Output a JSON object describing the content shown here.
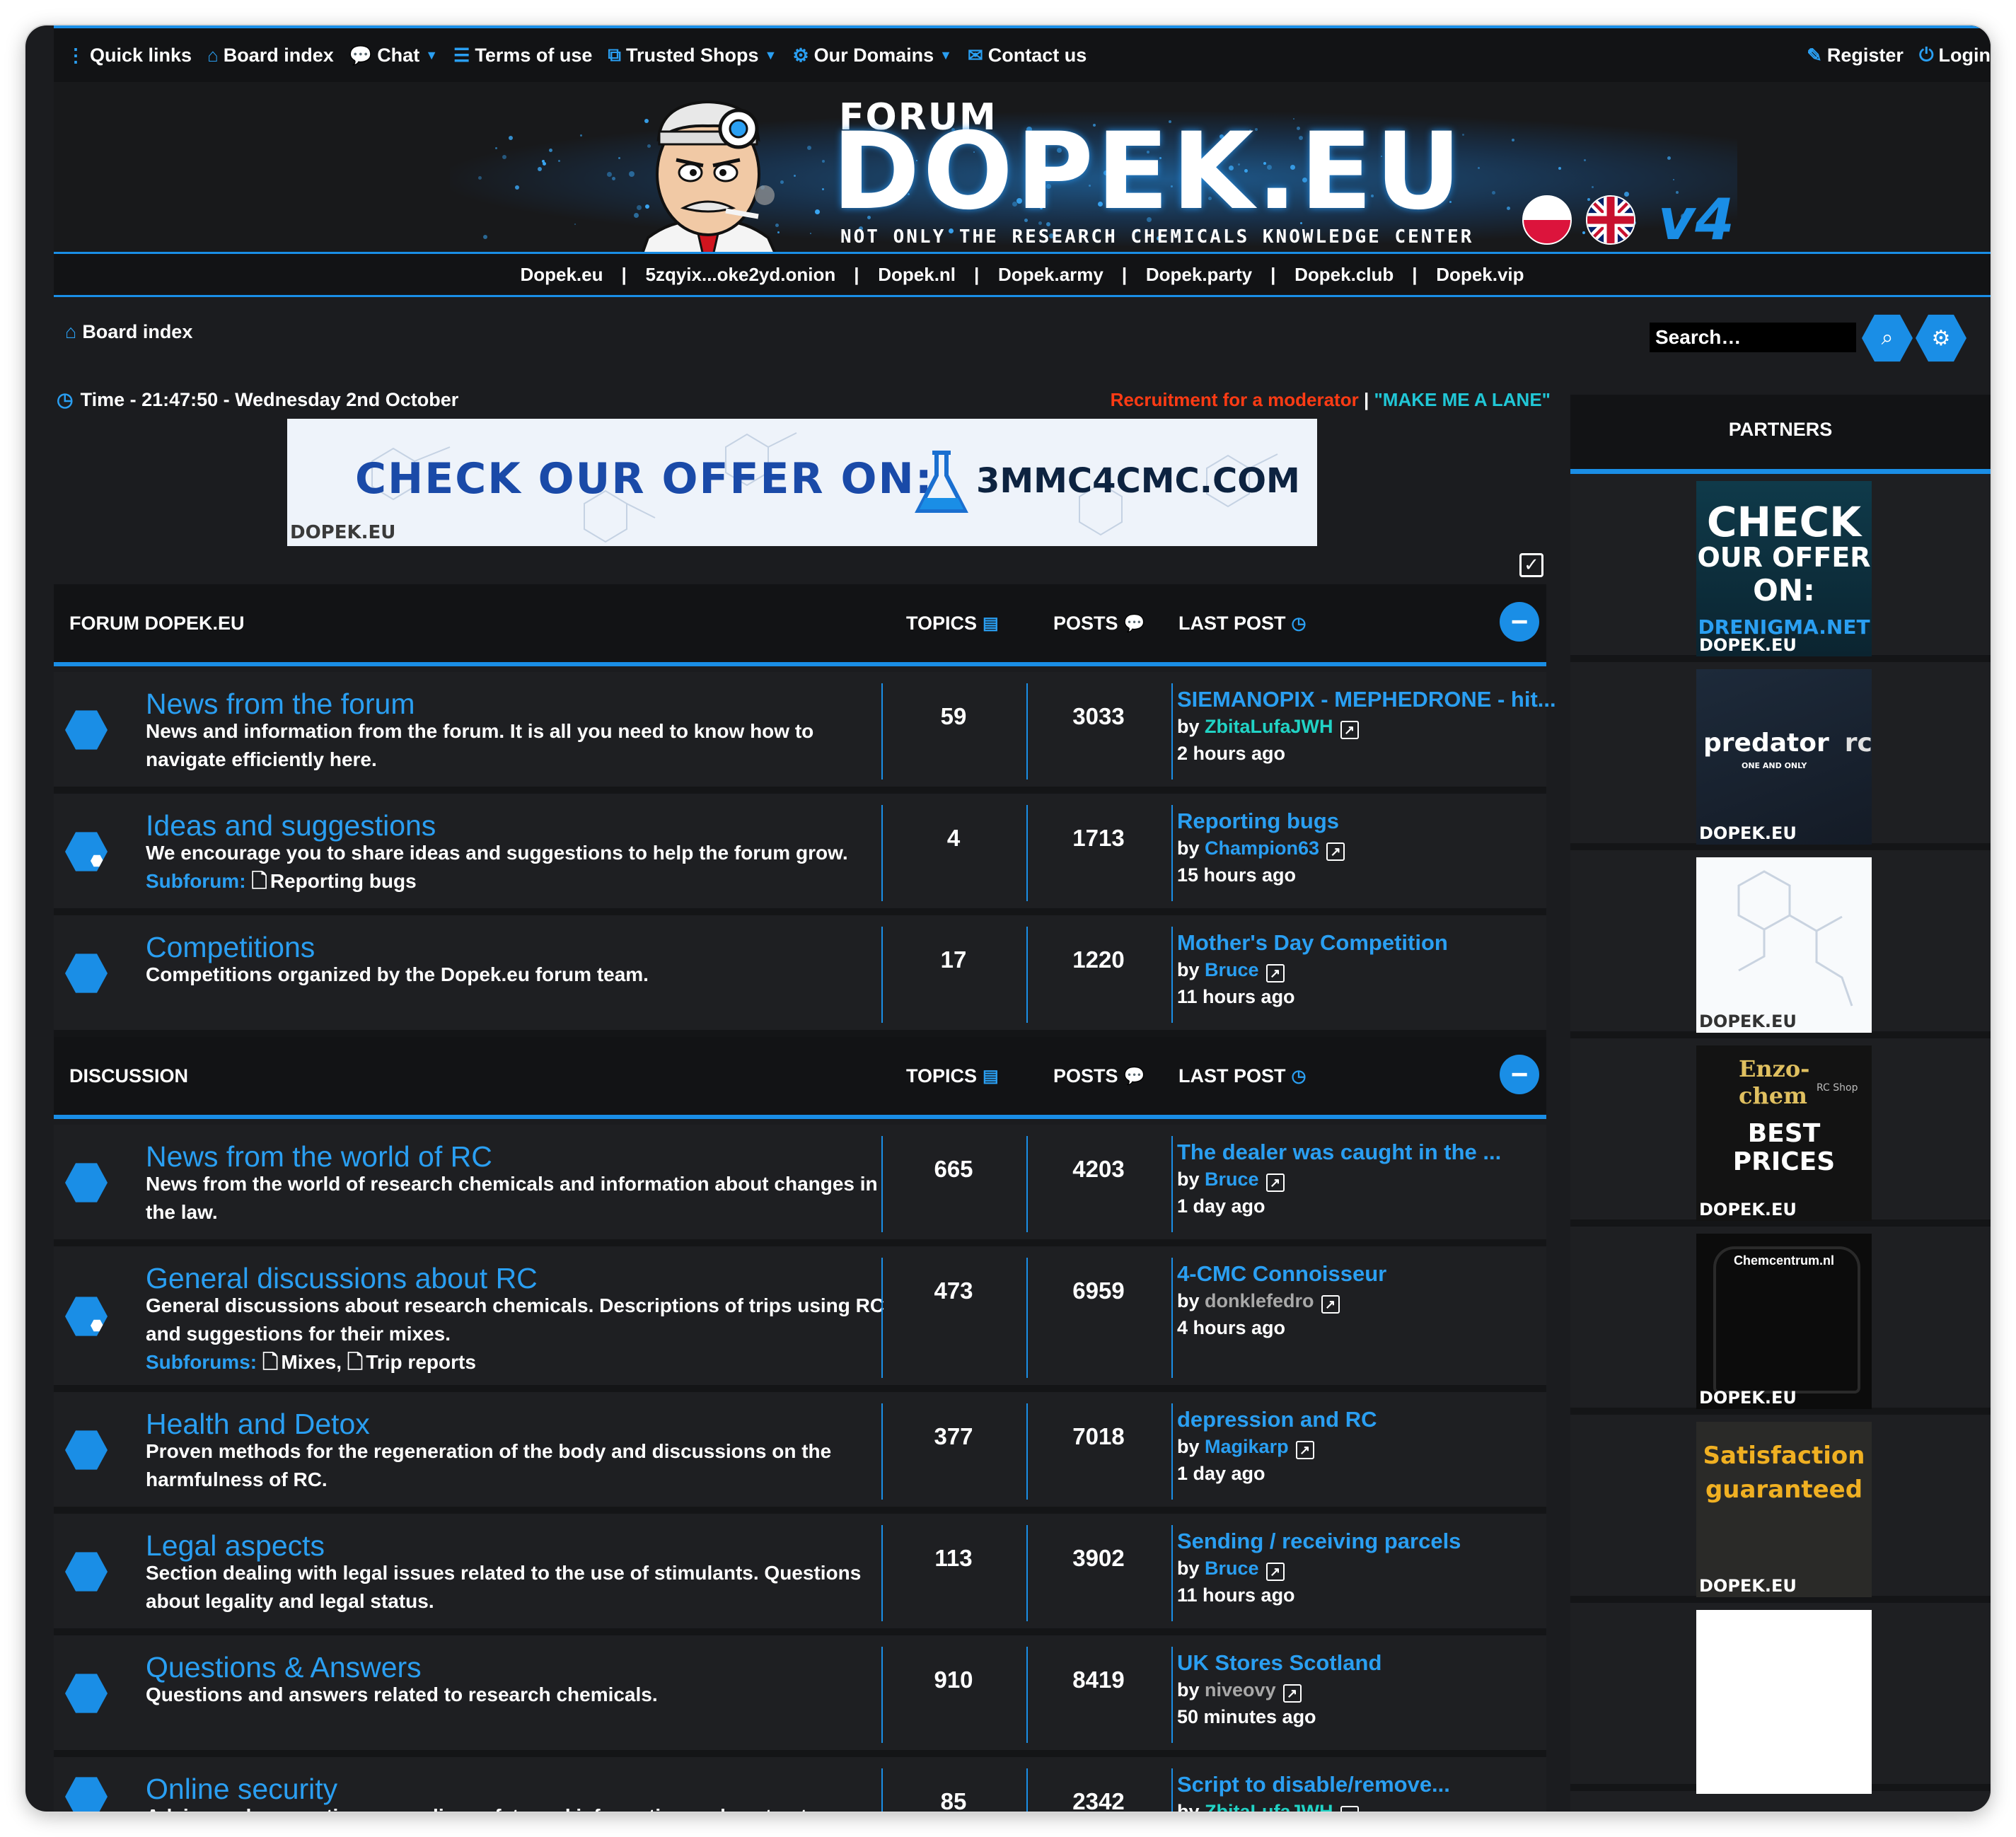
{
  "nav": {
    "left": [
      {
        "label": "Quick links",
        "icon": "menu-icon"
      },
      {
        "label": "Board index",
        "icon": "home-icon"
      },
      {
        "label": "Chat",
        "icon": "chat-icon",
        "dropdown": true
      },
      {
        "label": "Terms of use",
        "icon": "list-icon"
      },
      {
        "label": "Trusted Shops",
        "icon": "external-link-icon",
        "dropdown": true
      },
      {
        "label": "Our Domains",
        "icon": "gears-icon",
        "dropdown": true
      },
      {
        "label": "Contact us",
        "icon": "envelope-icon"
      }
    ],
    "right": [
      {
        "label": "Register",
        "icon": "edit-icon"
      },
      {
        "label": "Login",
        "icon": "power-icon"
      }
    ]
  },
  "banner": {
    "forum_word": "FORUM",
    "title": "DOPEK.EU",
    "subtitle": "NOT ONLY THE RESEARCH CHEMICALS KNOWLEDGE CENTER",
    "version": "v4"
  },
  "domains": [
    "Dopek.eu",
    "5zqyix...oke2yd.onion",
    "Dopek.nl",
    "Dopek.army",
    "Dopek.party",
    "Dopek.club",
    "Dopek.vip"
  ],
  "breadcrumb": {
    "label": "Board index"
  },
  "search": {
    "placeholder": "Search…"
  },
  "timebar": {
    "time": "Time - 21:47:50 - Wednesday 2nd October",
    "recruit": "Recruitment for a moderator",
    "separator": "|",
    "lane": "\"MAKE ME A LANE\""
  },
  "ad": {
    "text": "CHECK OUR OFFER ON:",
    "domain": "3MMC4CMC.COM",
    "watermark": "DOPEK.EU"
  },
  "columns": {
    "topics": "TOPICS",
    "posts": "POSTS",
    "last_post": "LAST POST"
  },
  "sections": [
    {
      "title": "FORUM DOPEK.EU",
      "forums": [
        {
          "name": "News from the forum",
          "desc": "News and information from the forum. It is all you need to know how to navigate efficiently here.",
          "topics": "59",
          "posts": "3033",
          "last_title": "SIEMANOPIX - MEPHEDRONE - hit...",
          "by": "by",
          "user": "ZbitaLufaJWH",
          "user_color": "green",
          "ago": "2 hours ago",
          "has_sub": false
        },
        {
          "name": "Ideas and suggestions",
          "desc": "We encourage you to share ideas and suggestions to help the forum grow.",
          "subforum_label": "Subforum:",
          "subforums": [
            "Reporting bugs"
          ],
          "topics": "4",
          "posts": "1713",
          "last_title": "Reporting bugs",
          "by": "by",
          "user": "Champion63",
          "user_color": "blue",
          "ago": "15 hours ago",
          "has_sub": true
        },
        {
          "name": "Competitions",
          "desc": "Competitions organized by the Dopek.eu forum team.",
          "topics": "17",
          "posts": "1220",
          "last_title": "Mother's Day Competition",
          "by": "by",
          "user": "Bruce",
          "user_color": "blue",
          "ago": "11 hours ago",
          "has_sub": false
        }
      ]
    },
    {
      "title": "DISCUSSION",
      "forums": [
        {
          "name": "News from the world of RC",
          "desc": "News from the world of research chemicals and information about changes in the law.",
          "topics": "665",
          "posts": "4203",
          "last_title": "The dealer was caught in the ...",
          "by": "by",
          "user": "Bruce",
          "user_color": "blue",
          "ago": "1 day ago",
          "has_sub": false
        },
        {
          "name": "General discussions about RC",
          "desc": "General discussions about research chemicals. Descriptions of trips using RC and suggestions for their mixes.",
          "subforum_label": "Subforums:",
          "subforums": [
            "Mixes,",
            "Trip reports"
          ],
          "topics": "473",
          "posts": "6959",
          "last_title": "4-CMC Connoisseur",
          "by": "by",
          "user": "donklefedro",
          "user_color": "grey",
          "ago": "4 hours ago",
          "has_sub": true
        },
        {
          "name": "Health and Detox",
          "desc": "Proven methods for the regeneration of the body and discussions on the harmfulness of RC.",
          "topics": "377",
          "posts": "7018",
          "last_title": "depression and RC",
          "by": "by",
          "user": "Magikarp",
          "user_color": "blue",
          "ago": "1 day ago",
          "has_sub": false
        },
        {
          "name": "Legal aspects",
          "desc": "Section dealing with legal issues related to the use of stimulants. Questions about legality and legal status.",
          "topics": "113",
          "posts": "3902",
          "last_title": "Sending / receiving parcels",
          "by": "by",
          "user": "Bruce",
          "user_color": "blue",
          "ago": "11 hours ago",
          "has_sub": false
        },
        {
          "name": "Questions & Answers",
          "desc": "Questions and answers related to research chemicals.",
          "topics": "910",
          "posts": "8419",
          "last_title": "UK Stores Scotland",
          "by": "by",
          "user": "niveovy",
          "user_color": "grey",
          "ago": "50 minutes ago",
          "has_sub": false
        },
        {
          "name": "Online security",
          "desc": "Advice and suggestions on online safety and information on how to stay",
          "topics": "85",
          "posts": "2342",
          "last_title": "Script to disable/remove...",
          "by": "by",
          "user": "ZbitaLufaJWH",
          "user_color": "green",
          "ago": "",
          "has_sub": false
        }
      ]
    }
  ],
  "partners": {
    "title": "PARTNERS",
    "items": [
      {
        "line1": "CHECK",
        "line2": "OUR OFFER",
        "line3": "ON:",
        "domain": "DRENIGMA.NET",
        "watermark": "DOPEK.EU"
      },
      {
        "name": "predator",
        "rc": "rc",
        "tagline": "ONE AND ONLY",
        "watermark": "DOPEK.EU"
      },
      {
        "watermark": "DOPEK.EU"
      },
      {
        "name": "Enzo-chem",
        "sub": "RC Shop",
        "line1": "BEST",
        "line2": "PRICES",
        "watermark": "DOPEK.EU"
      },
      {
        "name": "Chemcentrum.nl",
        "watermark": "DOPEK.EU"
      },
      {
        "line1": "Satisfaction",
        "line2": "guaranteed",
        "watermark": "DOPEK.EU"
      },
      {}
    ]
  },
  "colors": {
    "accent": "#1a8ee6",
    "background": "#1b1c1f",
    "recruit": "#ff3b14",
    "lane": "#21c7d6"
  }
}
